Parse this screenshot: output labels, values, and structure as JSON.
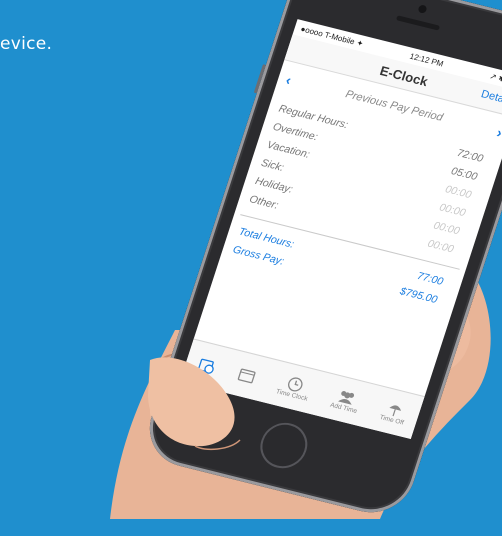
{
  "background": {
    "caption": "evice.",
    "color": "#1f8fce"
  },
  "status_bar": {
    "carrier": "●oooo T-Mobile ✦",
    "time": "12:12 PM",
    "right": "↗ ✱ ▮▮▮"
  },
  "nav": {
    "title": "E-Clock",
    "details": "Details"
  },
  "period": {
    "label": "Previous Pay Period",
    "prev_icon": "chevron-left-icon",
    "next_icon": "chevron-right-icon"
  },
  "hours": [
    {
      "label": "Regular Hours:",
      "value": "72:00",
      "dim": false
    },
    {
      "label": "Overtime:",
      "value": "05:00",
      "dim": false
    },
    {
      "label": "Vacation:",
      "value": "00:00",
      "dim": true
    },
    {
      "label": "Sick:",
      "value": "00:00",
      "dim": true
    },
    {
      "label": "Holiday:",
      "value": "00:00",
      "dim": true
    },
    {
      "label": "Other:",
      "value": "00:00",
      "dim": true
    }
  ],
  "totals": [
    {
      "label": "Total Hours:",
      "value": "77:00"
    },
    {
      "label": "Gross Pay:",
      "value": "$795.00"
    }
  ],
  "tabs": [
    {
      "label": "",
      "icon": "calendar-clock-icon",
      "active": true
    },
    {
      "label": "",
      "icon": "calendar-icon",
      "active": false
    },
    {
      "label": "Time Clock",
      "icon": "clock-icon",
      "active": false
    },
    {
      "label": "Add Time",
      "icon": "people-icon",
      "active": false
    },
    {
      "label": "Time Off",
      "icon": "beach-umbrella-icon",
      "active": false
    }
  ],
  "accent_color": "#1a7de0"
}
